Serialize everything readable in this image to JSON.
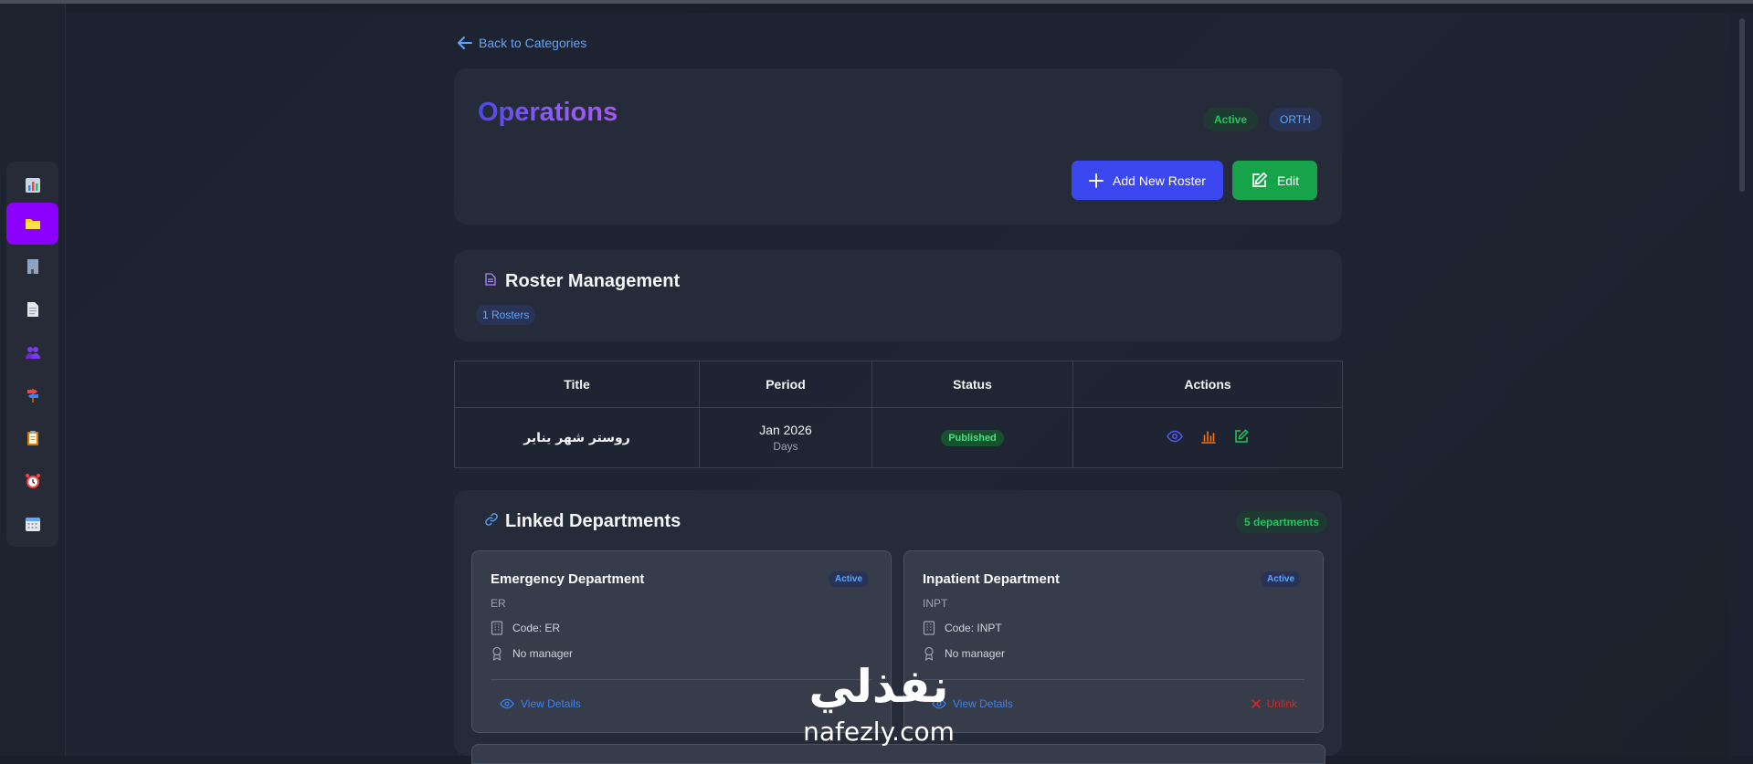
{
  "sidebar": {
    "items": [
      {
        "icon": "chart-icon",
        "active": false
      },
      {
        "icon": "folder-icon",
        "active": true
      },
      {
        "icon": "building-icon",
        "active": false
      },
      {
        "icon": "document-icon",
        "active": false
      },
      {
        "icon": "users-icon",
        "active": false
      },
      {
        "icon": "signpost-icon",
        "active": false
      },
      {
        "icon": "clipboard-icon",
        "active": false
      },
      {
        "icon": "alarm-clock-icon",
        "active": false
      },
      {
        "icon": "calendar-icon",
        "active": false
      }
    ]
  },
  "back_link": "Back to Categories",
  "header": {
    "title": "Operations",
    "status_badge": "Active",
    "code_badge": "ORTH",
    "add_button": "Add New Roster",
    "edit_button": "Edit"
  },
  "roster_section": {
    "title": "Roster Management",
    "count_label": "1 Rosters",
    "columns": [
      "Title",
      "Period",
      "Status",
      "Actions"
    ],
    "rows": [
      {
        "title": "روستر شهر يناير",
        "period": "Jan 2026",
        "period_sub": "Days",
        "status": "Published",
        "actions": [
          "eye-icon",
          "bar-chart-icon",
          "edit-icon"
        ]
      }
    ]
  },
  "departments_section": {
    "title": "Linked Departments",
    "count_label": "5 departments",
    "departments": [
      {
        "name": "Emergency Department",
        "abbr": "ER",
        "status": "Active",
        "code": "Code: ER",
        "manager": "No manager",
        "view_label": "View Details"
      },
      {
        "name": "Inpatient Department",
        "abbr": "INPT",
        "status": "Active",
        "code": "Code: INPT",
        "manager": "No manager",
        "view_label": "View Details",
        "unlink_label": "Unlink"
      }
    ]
  },
  "watermark": {
    "arabic": "نفذلي",
    "latin": "nafezly.com"
  },
  "colors": {
    "accent_blue": "#3b48f0",
    "accent_green": "#16a34a",
    "sidebar_active": "#8b00ff",
    "title_gradient_start": "#4f46e5",
    "title_gradient_end": "#a855f7",
    "danger": "#dc2626"
  }
}
